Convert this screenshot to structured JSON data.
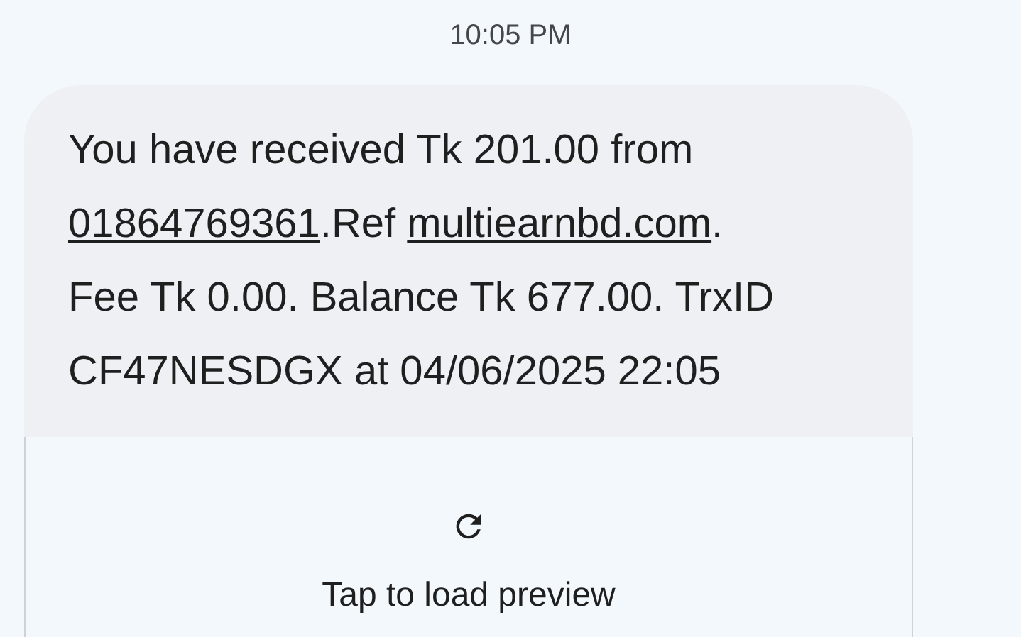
{
  "timestamp": "10:05 PM",
  "message": {
    "lines": [
      [
        {
          "kind": "text",
          "text": "You have received Tk 201.00 from"
        }
      ],
      [
        {
          "kind": "link",
          "text": "01864769361"
        },
        {
          "kind": "text",
          "text": ".Ref "
        },
        {
          "kind": "link",
          "text": "multiearnbd.com"
        },
        {
          "kind": "text",
          "text": "."
        }
      ],
      [
        {
          "kind": "text",
          "text": "Fee Tk 0.00. Balance Tk 677.00. TrxID"
        }
      ],
      [
        {
          "kind": "text",
          "text": "CF47NESDGX at 04/06/2025 22:05"
        }
      ]
    ]
  },
  "preview": {
    "label": "Tap to load preview"
  }
}
